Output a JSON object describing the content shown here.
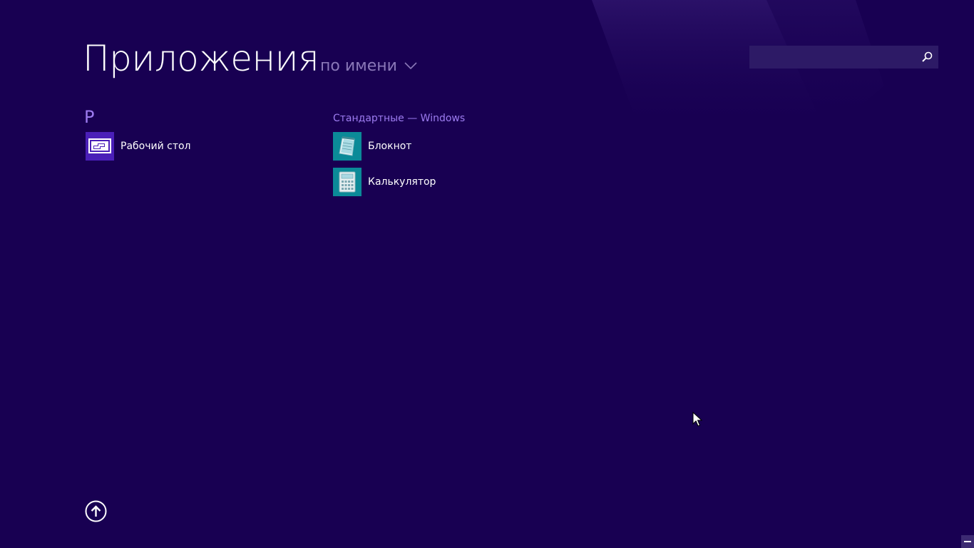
{
  "header": {
    "title": "Приложения",
    "sort_label": "по имени"
  },
  "search": {
    "value": "",
    "placeholder": ""
  },
  "groups": [
    {
      "header": "Р",
      "items": [
        {
          "label": "Рабочий стол",
          "icon": "desktop-icon",
          "tile_color": "#4a1fb8"
        }
      ]
    },
    {
      "header": "Стандартные — Windows",
      "items": [
        {
          "label": "Блокнот",
          "icon": "notepad-icon",
          "tile_color": "#0b8a98"
        },
        {
          "label": "Калькулятор",
          "icon": "calculator-icon",
          "tile_color": "#0b8a98"
        }
      ]
    }
  ],
  "colors": {
    "background": "#180052",
    "accent": "#9d7cf0",
    "sort_label": "#8a78b8",
    "search_box": "#2d1a66"
  }
}
